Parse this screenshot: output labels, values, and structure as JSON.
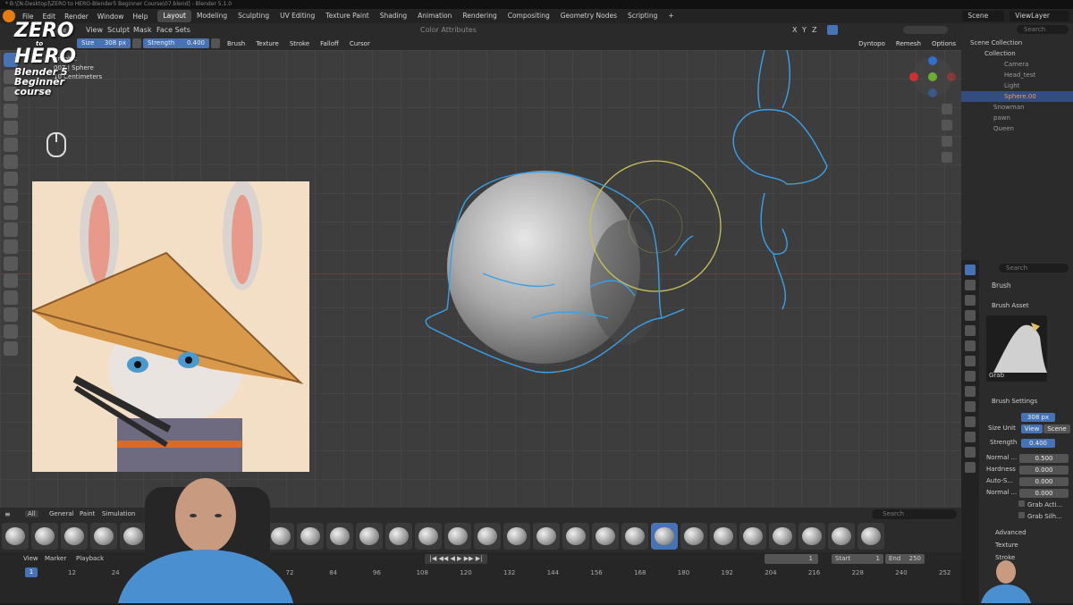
{
  "window": {
    "title": "* B:\\[N-Desktop]\\ZERO to HERO-Blender5 Beginner Course\\07.blend] - Blender 5.1.0"
  },
  "menus": [
    "File",
    "Edit",
    "Render",
    "Window",
    "Help"
  ],
  "workspaces": [
    {
      "label": "Layout",
      "active": true
    },
    {
      "label": "Modeling",
      "active": false
    },
    {
      "label": "Sculpting",
      "active": false
    },
    {
      "label": "UV Editing",
      "active": false
    },
    {
      "label": "Texture Paint",
      "active": false
    },
    {
      "label": "Shading",
      "active": false
    },
    {
      "label": "Animation",
      "active": false
    },
    {
      "label": "Rendering",
      "active": false
    },
    {
      "label": "Compositing",
      "active": false
    },
    {
      "label": "Geometry Nodes",
      "active": false
    },
    {
      "label": "Scripting",
      "active": false
    }
  ],
  "top_right": {
    "scene": "Scene",
    "view_layer": "ViewLayer"
  },
  "header": {
    "mode": "de",
    "menus": [
      "View",
      "Sculpt",
      "Mask",
      "Face Sets"
    ],
    "color_attributes": "Color Attributes",
    "axes": [
      "X",
      "Y",
      "Z"
    ],
    "dyntopo": "Dyntopo",
    "remesh": "Remesh",
    "options": "Options"
  },
  "tool_settings": {
    "brush_name": "Grab",
    "size_label": "Size",
    "size_value": "308 px",
    "strength_label": "Strength",
    "strength_value": "0.400",
    "dropdowns": [
      "Brush",
      "Texture",
      "Stroke",
      "Falloff",
      "Cursor"
    ]
  },
  "viewport_overlay": {
    "line1": "graphic",
    "line2": "007 | Sphere",
    "line3": "10 Centimeters"
  },
  "logo": {
    "line1": "ZERO",
    "line2": "to",
    "line3": "HERO",
    "line4": "Blender 5",
    "line5": "Beginner",
    "line6": "course"
  },
  "outliner": {
    "search_placeholder": "Search",
    "root": "Scene Collection",
    "items": [
      {
        "label": "Collection",
        "indent": 1,
        "selected": false
      },
      {
        "label": "Camera",
        "indent": 2,
        "selected": false
      },
      {
        "label": "Head_test",
        "indent": 2,
        "selected": false
      },
      {
        "label": "Light",
        "indent": 2,
        "selected": false
      },
      {
        "label": "Sphere.00",
        "indent": 2,
        "selected": true
      },
      {
        "label": "Snowman",
        "indent": 1,
        "selected": false
      },
      {
        "label": "pawn",
        "indent": 1,
        "selected": false
      },
      {
        "label": "Queen",
        "indent": 1,
        "selected": false
      }
    ]
  },
  "properties": {
    "search_placeholder": "Search",
    "brush_label": "Brush",
    "brush_asset_label": "Brush Asset",
    "brush_asset_name": "Grab",
    "brush_settings_label": "Brush Settings",
    "rows": [
      {
        "label": "Size",
        "value": "308 px"
      },
      {
        "label": "Size Unit",
        "value": "View",
        "alt": "Scene"
      },
      {
        "label": "Strength",
        "value": "0.400"
      },
      {
        "label": "Normal ...",
        "value": "0.500"
      },
      {
        "label": "Hardness",
        "value": "0.000"
      },
      {
        "label": "Auto-S...",
        "value": "0.000"
      },
      {
        "label": "Normal ...",
        "value": "0.000"
      }
    ],
    "checkboxes": [
      "Grab Acti...",
      "Grab Silh..."
    ],
    "sections": [
      "Advanced",
      "Texture",
      "Stroke"
    ]
  },
  "asset_shelf": {
    "tabs": [
      "All",
      "General",
      "Paint",
      "Simulation"
    ],
    "search_placeholder": "Search"
  },
  "timeline": {
    "menus": [
      "View",
      "Marker",
      "Playback"
    ],
    "current_frame": "1",
    "start_label": "Start",
    "start_value": "1",
    "end_label": "End",
    "end_value": "250",
    "frame_indicator": "1",
    "ruler": [
      "12",
      "24",
      "36",
      "48",
      "60",
      "72",
      "84",
      "96",
      "108",
      "120",
      "132",
      "144",
      "156",
      "168",
      "180",
      "192",
      "204",
      "216",
      "228",
      "240",
      "252"
    ]
  },
  "colors": {
    "accent": "#4772b3",
    "grease_pencil": "#3aa0e8",
    "brush_circle": "#c8c25a"
  }
}
